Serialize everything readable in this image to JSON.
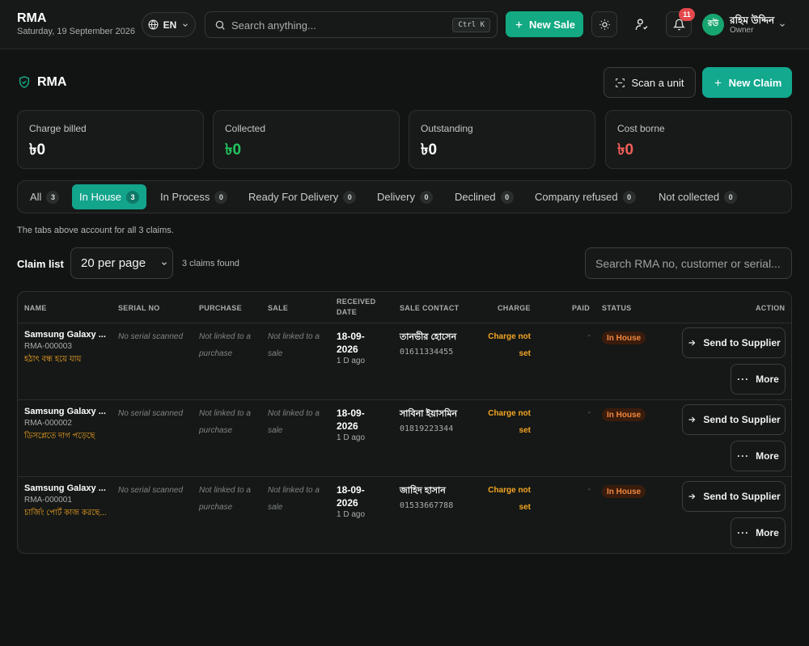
{
  "header": {
    "title": "RMA",
    "date": "Saturday, 19 September 2026",
    "lang": "EN",
    "search_placeholder": "Search anything...",
    "search_shortcut": "Ctrl K",
    "new_sale_label": "New Sale",
    "notification_count": "11",
    "user_initials": "রউ",
    "user_name": "রহিম উদ্দিন",
    "user_role": "Owner"
  },
  "page": {
    "title": "RMA",
    "scan_label": "Scan a unit",
    "new_claim_label": "New Claim"
  },
  "stats": [
    {
      "label": "Charge billed",
      "value": "৳0",
      "color": "#ffffff"
    },
    {
      "label": "Collected",
      "value": "৳0",
      "color": "#22c55e"
    },
    {
      "label": "Outstanding",
      "value": "৳0",
      "color": "#ffffff"
    },
    {
      "label": "Cost borne",
      "value": "৳0",
      "color": "#f25f5c"
    }
  ],
  "tabs": [
    {
      "label": "All",
      "count": "3"
    },
    {
      "label": "In House",
      "count": "3",
      "active": true
    },
    {
      "label": "In Process",
      "count": "0"
    },
    {
      "label": "Ready For Delivery",
      "count": "0"
    },
    {
      "label": "Delivery",
      "count": "0"
    },
    {
      "label": "Declined",
      "count": "0"
    },
    {
      "label": "Company refused",
      "count": "0"
    },
    {
      "label": "Not collected",
      "count": "0"
    }
  ],
  "tabs_note": "The tabs above account for all 3 claims.",
  "list": {
    "label": "Claim list",
    "per_page": "20 per page",
    "claims_found": "3 claims found",
    "search_placeholder": "Search RMA no, customer or serial..."
  },
  "table": {
    "columns": {
      "name": "NAME",
      "serial": "SERIAL NO",
      "purchase": "PURCHASE",
      "sale": "SALE",
      "received_1": "RECEIVED",
      "received_2": "DATE",
      "contact": "SALE CONTACT",
      "charge": "CHARGE",
      "paid": "PAID",
      "status": "STATUS",
      "action": "ACTION"
    },
    "rows": [
      {
        "product": "Samsung Galaxy ...",
        "rma_no": "RMA-000003",
        "issue": "হঠাৎ বন্ধ হয়ে যায়",
        "serial": "No serial scanned",
        "purchase_1": "Not linked to a",
        "purchase_2": "purchase",
        "sale_1": "Not linked to a",
        "sale_2": "sale",
        "date_1": "18-09-",
        "date_2": "2026",
        "ago": "1 D ago",
        "contact_name": "তানভীর হোসেন",
        "contact_phone": "01611334455",
        "charge_1": "Charge not",
        "charge_2": "set",
        "paid": "-",
        "status": "In House",
        "action_primary": "Send to Supplier",
        "action_more": "More"
      },
      {
        "product": "Samsung Galaxy ...",
        "rma_no": "RMA-000002",
        "issue": "ডিসপ্লেতে দাগ পড়েছে",
        "serial": "No serial scanned",
        "purchase_1": "Not linked to a",
        "purchase_2": "purchase",
        "sale_1": "Not linked to a",
        "sale_2": "sale",
        "date_1": "18-09-",
        "date_2": "2026",
        "ago": "1 D ago",
        "contact_name": "সাবিনা ইয়াসমিন",
        "contact_phone": "01819223344",
        "charge_1": "Charge not",
        "charge_2": "set",
        "paid": "-",
        "status": "In House",
        "action_primary": "Send to Supplier",
        "action_more": "More"
      },
      {
        "product": "Samsung Galaxy ...",
        "rma_no": "RMA-000001",
        "issue": "চার্জিং পোর্ট কাজ করছে...",
        "serial": "No serial scanned",
        "purchase_1": "Not linked to a",
        "purchase_2": "purchase",
        "sale_1": "Not linked to a",
        "sale_2": "sale",
        "date_1": "18-09-",
        "date_2": "2026",
        "ago": "1 D ago",
        "contact_name": "জাহিদ হাসান",
        "contact_phone": "01533667788",
        "charge_1": "Charge not",
        "charge_2": "set",
        "paid": "-",
        "status": "In House",
        "action_primary": "Send to Supplier",
        "action_more": "More"
      }
    ]
  },
  "icons": {
    "globe": "globe-icon",
    "search": "search-icon",
    "plus": "plus-icon",
    "theme": "sun-icon",
    "user": "user-check-icon",
    "bell": "bell-icon",
    "shield": "shield-check-icon",
    "scan": "scan-icon",
    "arrow": "arrow-right-icon",
    "more": "ellipsis-icon"
  },
  "colors": {
    "accent": "#13a982",
    "warning": "#f5a524",
    "status_bg": "#3a1c0d",
    "status_text": "#f0883e",
    "danger": "#e5484d"
  }
}
